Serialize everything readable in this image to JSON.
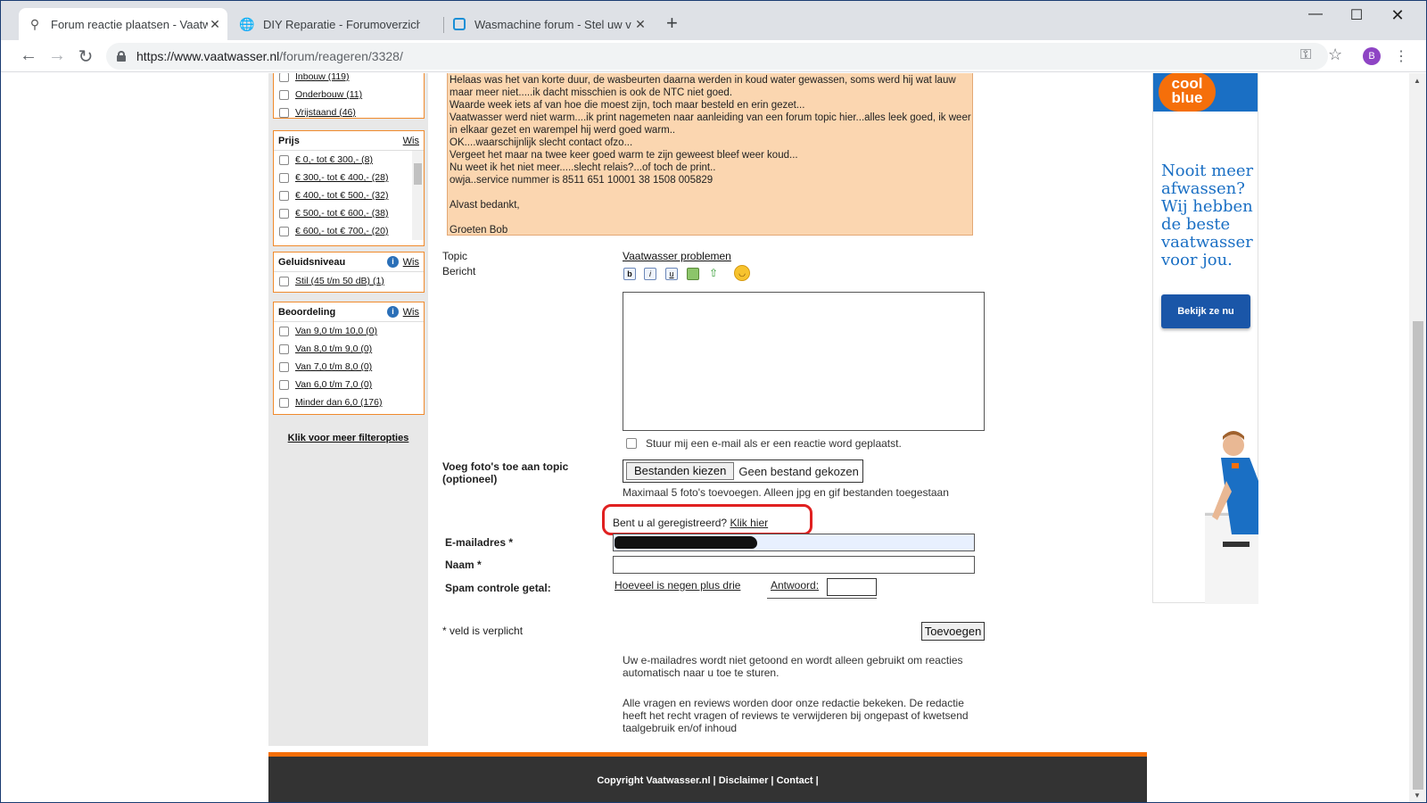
{
  "browser": {
    "tabs": [
      {
        "title": "Forum reactie plaatsen - Vaatwasser.nl",
        "icon": "vaatwasser-favicon"
      },
      {
        "title": "DIY Reparatie - Forumoverzicht",
        "icon": "globe-icon"
      },
      {
        "title": "Wasmachine forum - Stel uw vraag",
        "icon": "wasmachine-favicon"
      }
    ],
    "url_host": "https://www.vaatwasser.nl",
    "url_path": "/forum/reageren/3328/",
    "avatar_letter": "B"
  },
  "sidebar": {
    "type_items": [
      "Inbouw (119)",
      "Onderbouw (11)",
      "Vrijstaand (46)"
    ],
    "price": {
      "title": "Prijs",
      "clear": "Wis",
      "items": [
        "€ 0,- tot € 300,- (8)",
        "€ 300,- tot € 400,- (28)",
        "€ 400,- tot € 500,- (32)",
        "€ 500,- tot € 600,- (38)",
        "€ 600,- tot € 700,- (20)"
      ]
    },
    "noise": {
      "title": "Geluidsniveau",
      "clear": "Wis",
      "items": [
        "Stil (45 t/m 50 dB) (1)"
      ]
    },
    "rating": {
      "title": "Beoordeling",
      "clear": "Wis",
      "items": [
        "Van 9,0 t/m 10,0 (0)",
        "Van 8,0 t/m 9,0 (0)",
        "Van 7,0 t/m 8,0 (0)",
        "Van 6,0 t/m 7,0 (0)",
        "Minder dan 6,0 (176)"
      ]
    },
    "more_filters": "Klik voor meer filteropties"
  },
  "quote": "Helaas was het van korte duur, de wasbeurten daarna werden in koud water gewassen, soms werd hij wat lauw maar meer niet.....ik dacht misschien is ook de NTC niet goed.\nWaarde week iets af van hoe die moest zijn, toch maar besteld en erin gezet...\nVaatwasser werd niet warm....ik print nagemeten naar aanleiding van een forum topic hier...alles leek goed, ik weer in elkaar gezet en warempel hij werd goed warm..\nOK....waarschijnlijk slecht contact ofzo...\nVergeet het maar na twee keer goed warm te zijn geweest bleef weer koud...\nNu weet ik het niet meer.....slecht relais?...of toch de print..\nowja..service nummer is 8511 651 10001 38 1508 005829\n\nAlvast bedankt,\n\nGroeten Bob",
  "form": {
    "topic_label": "Topic",
    "topic_value": "Vaatwasser problemen",
    "message_label": "Bericht",
    "editor": {
      "bold": "b",
      "italic": "i",
      "underline": "u"
    },
    "notify_label": "Stuur mij een e-mail als er een reactie word geplaatst.",
    "photos_label": "Voeg foto's toe aan topic",
    "photos_optional": "(optioneel)",
    "file_button": "Bestanden kiezen",
    "file_status": "Geen bestand gekozen",
    "file_help": "Maximaal 5 foto's toevoegen. Alleen jpg en gif bestanden toegestaan",
    "registered_text": "Bent u al geregistreerd?",
    "registered_link": "Klik hier",
    "email_label": "E-mailadres *",
    "name_label": "Naam *",
    "spam_label": "Spam controle getal:",
    "spam_question": "Hoeveel is negen plus drie",
    "spam_answer_label": "Antwoord:",
    "required_note": "* veld is verplicht",
    "submit": "Toevoegen",
    "note1": "Uw e-mailadres wordt niet getoond en wordt alleen gebruikt om reacties automatisch naar u toe te sturen.",
    "note2": "Alle vragen en reviews worden door onze redactie bekeken. De redactie heeft het recht vragen of reviews te verwijderen bij ongepast of kwetsend taalgebruik en/of inhoud"
  },
  "ad": {
    "logo_line1": "cool",
    "logo_line2": "blue",
    "headline": "Nooit meer afwassen? Wij hebben de beste vaatwasser voor jou.",
    "cta": "Bekijk ze nu"
  },
  "footer": {
    "copyright": "Copyright Vaatwasser.nl",
    "disclaimer": "Disclaimer",
    "contact": "Contact"
  },
  "colors": {
    "accent": "#f56f0a",
    "filter_border": "#f08a2c",
    "quote_bg": "#fbd6b0",
    "highlight": "#e02020"
  }
}
